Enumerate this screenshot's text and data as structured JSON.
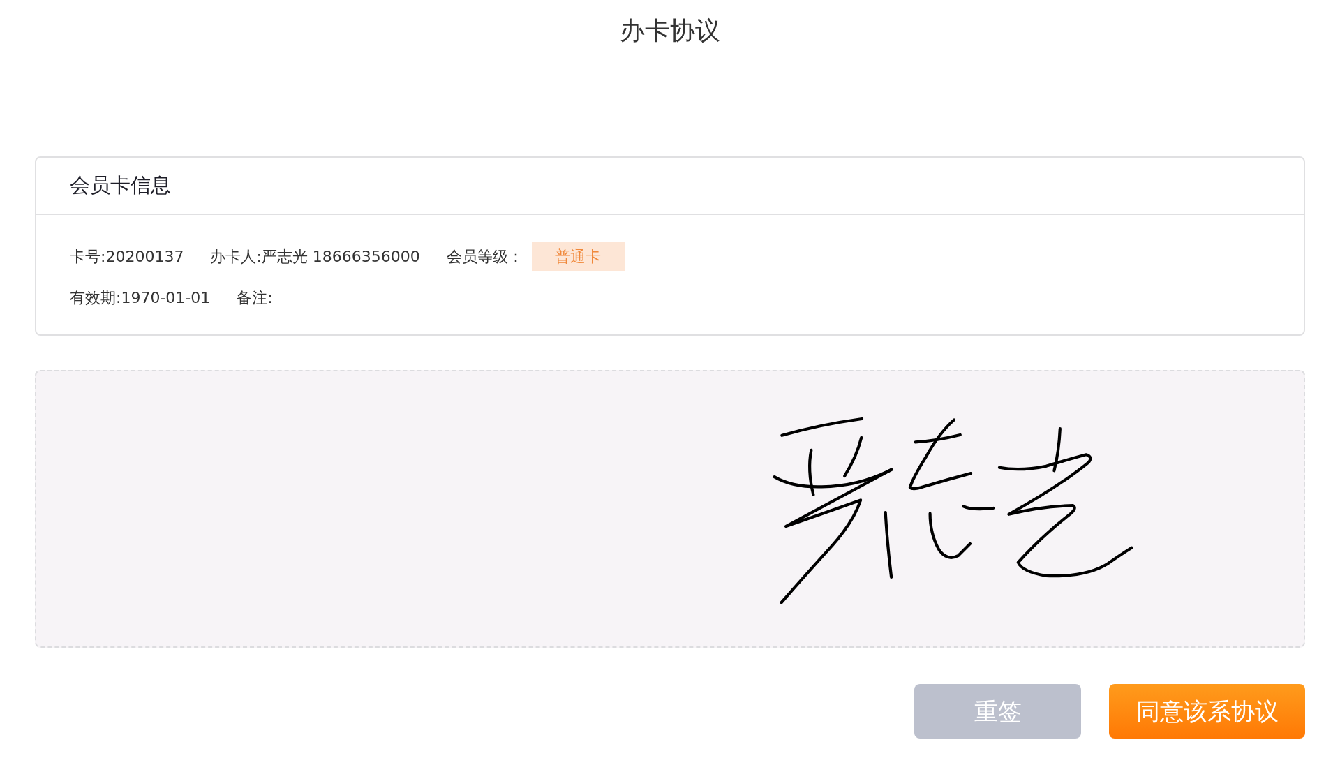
{
  "page_title": "办卡协议",
  "card": {
    "title": "会员卡信息",
    "rows": [
      [
        {
          "kind": "text",
          "text": "卡号:20200137"
        },
        {
          "kind": "text",
          "text": "办卡人:严志光 18666356000"
        },
        {
          "kind": "tag",
          "label": "会员等级：",
          "tag": "普通卡"
        }
      ],
      [
        {
          "kind": "text",
          "text": "有效期:1970-01-01"
        },
        {
          "kind": "text",
          "text": "备注:"
        }
      ]
    ]
  },
  "signature_pad": {
    "signed": true
  },
  "buttons": [
    {
      "kind": "secondary",
      "label": "重签"
    },
    {
      "kind": "primary",
      "label": "同意该系协议"
    }
  ]
}
